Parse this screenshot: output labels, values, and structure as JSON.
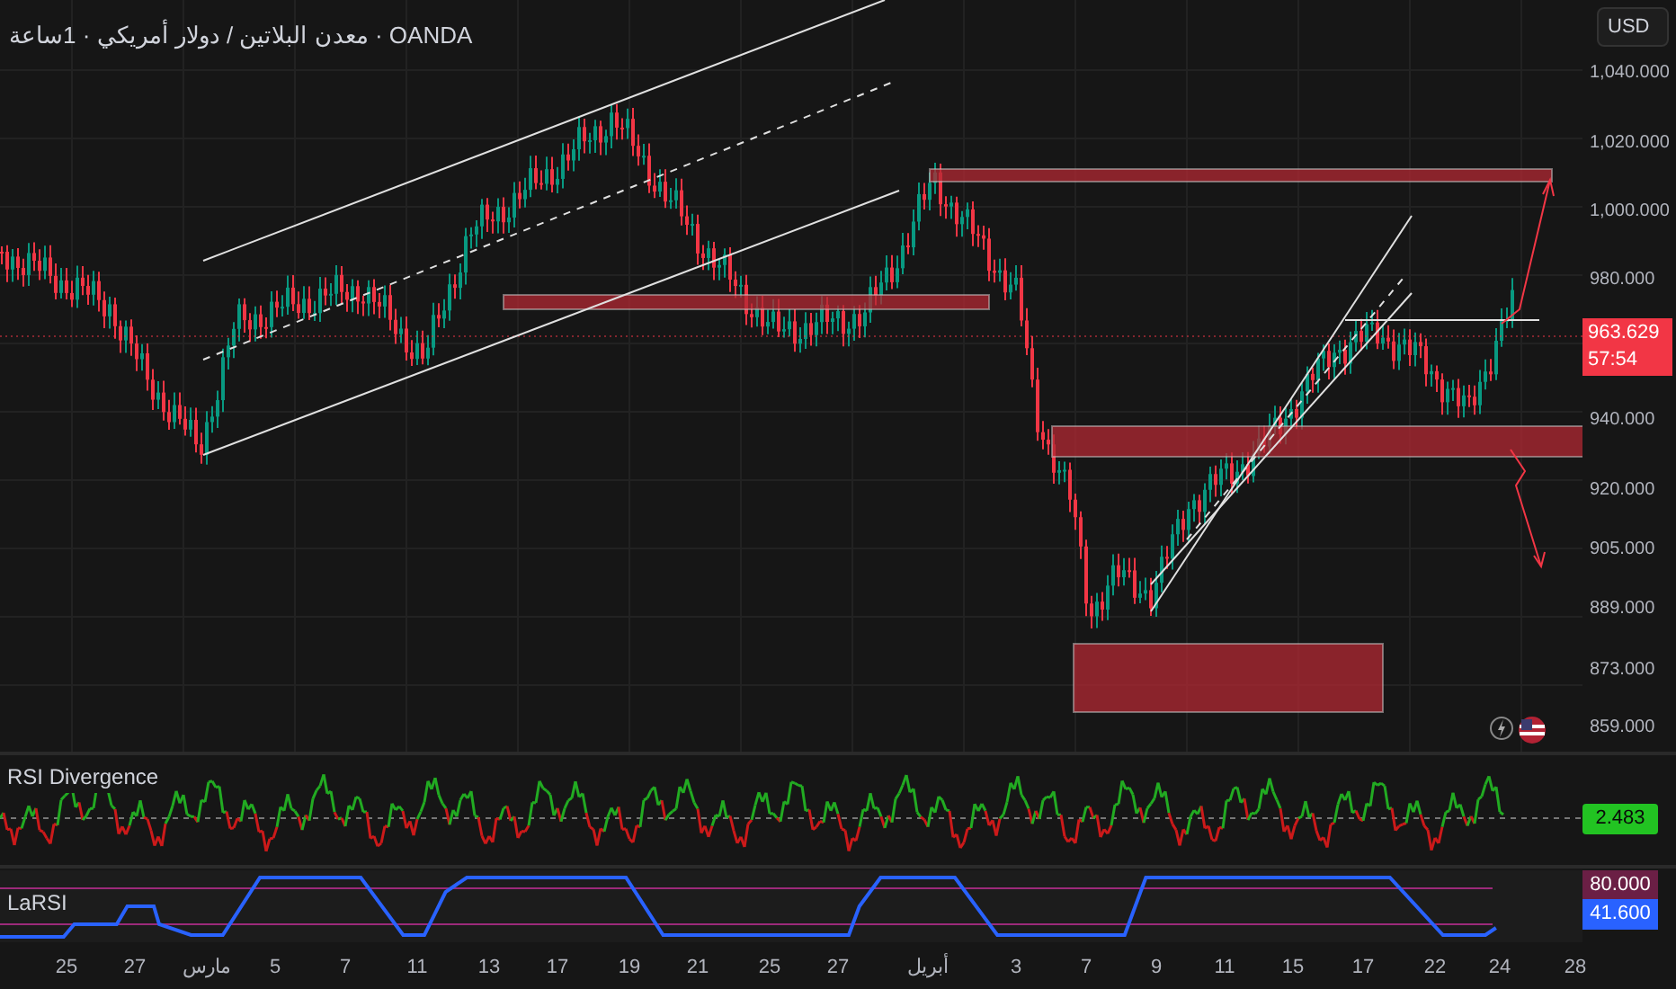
{
  "header": {
    "title": "OANDA · معدن البلاتين / دولار أمريكي · 1ساعة"
  },
  "price_axis": {
    "currency": "USD",
    "labels": [
      "1,040.000",
      "1,020.000",
      "1,000.000",
      "980.000",
      "940.000",
      "920.000",
      "905.000",
      "889.000",
      "873.000",
      "859.000"
    ],
    "last_price": "963.629",
    "countdown": "57:54"
  },
  "rsi_pane": {
    "title": "RSI Divergence",
    "value": "2.483"
  },
  "larsi_pane": {
    "title": "LaRSI",
    "upper": "80.000",
    "value": "41.600"
  },
  "time_axis": {
    "labels": [
      "25",
      "27",
      "مارس",
      "5",
      "7",
      "11",
      "13",
      "17",
      "19",
      "21",
      "25",
      "27",
      "أبريل",
      "3",
      "7",
      "9",
      "11",
      "15",
      "17",
      "22",
      "24",
      "28"
    ]
  }
}
